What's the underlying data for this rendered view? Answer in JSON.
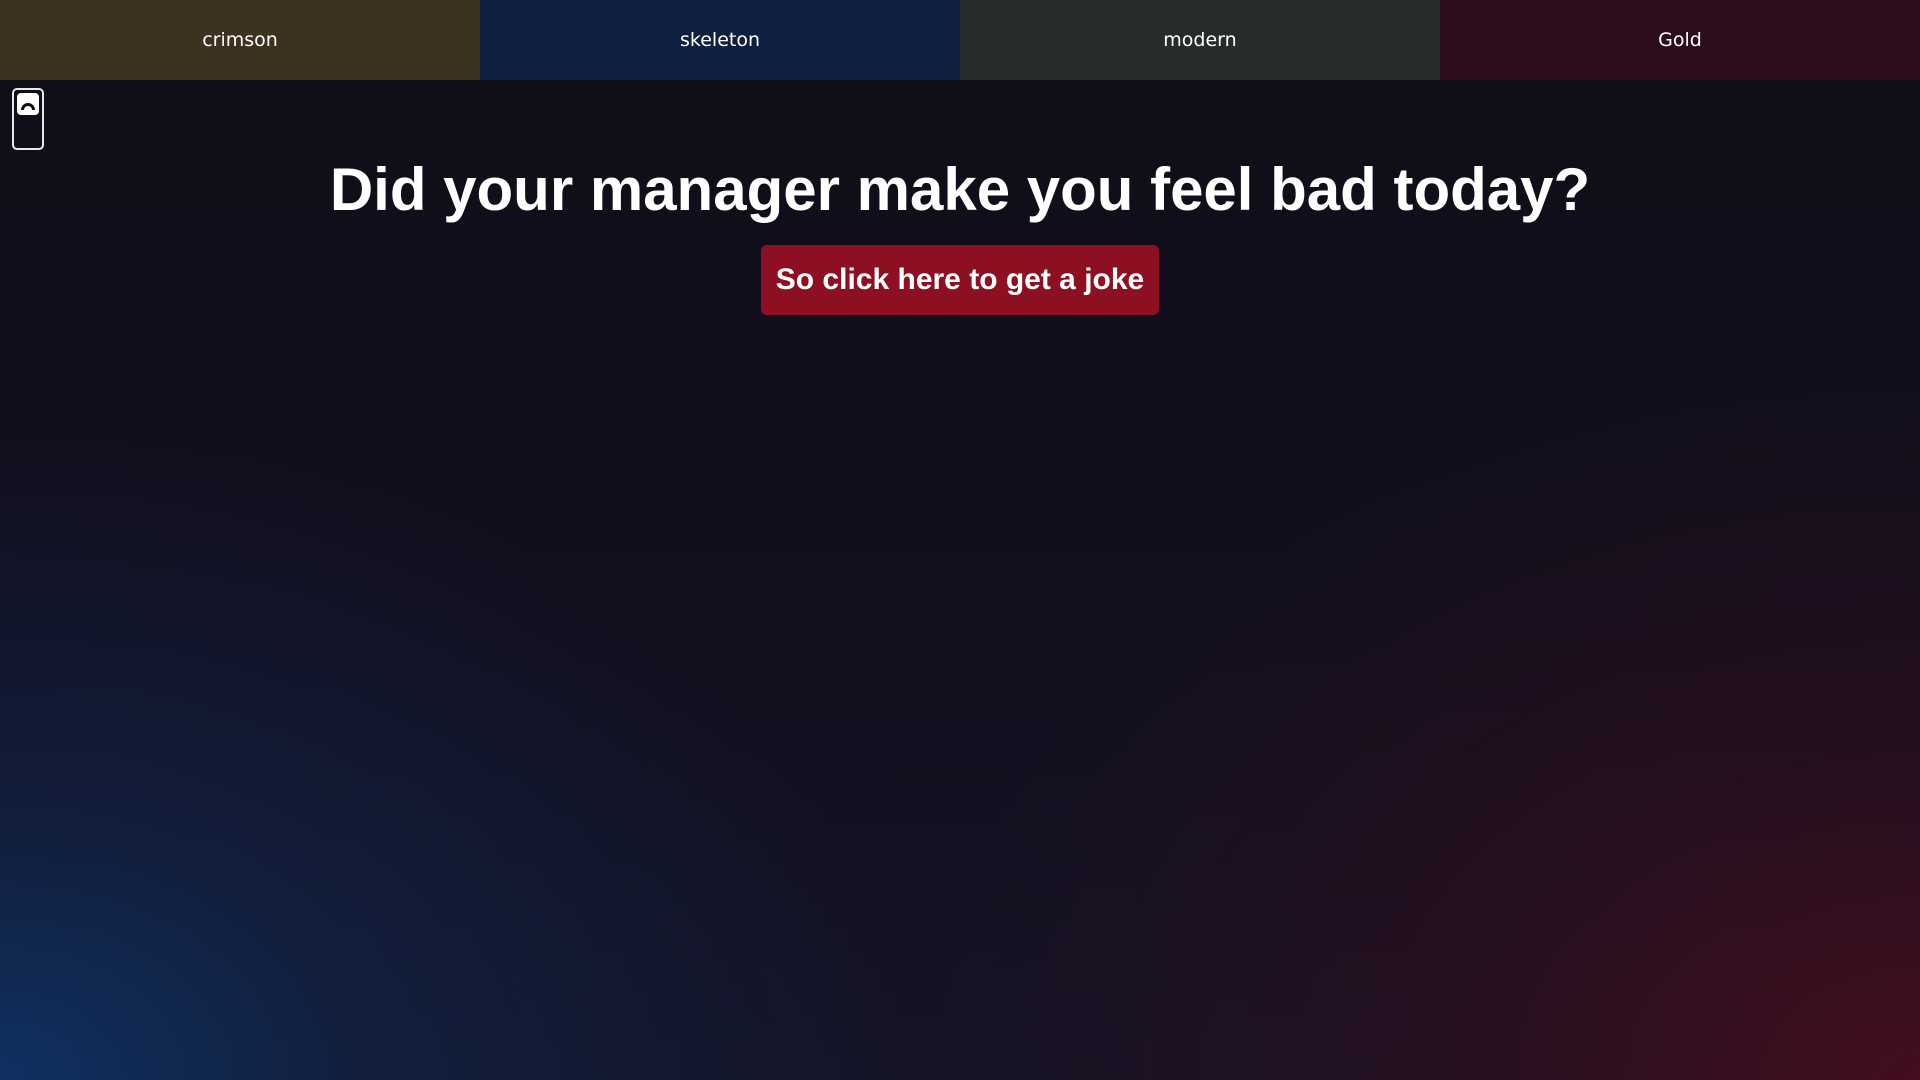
{
  "theme_bar": {
    "tabs": [
      {
        "label": "crimson",
        "color": "#3d321f"
      },
      {
        "label": "skeleton",
        "color": "#0f1f40"
      },
      {
        "label": "modern",
        "color": "#262c2b"
      },
      {
        "label": "Gold",
        "color": "#2c0d1b"
      }
    ]
  },
  "theme_toggle": {
    "icon": "half-circle-icon"
  },
  "main": {
    "headline": "Did your manager make you feel bad today?",
    "joke_button_label": "So click here to get a joke",
    "joke_button_color": "#8c0f22"
  }
}
